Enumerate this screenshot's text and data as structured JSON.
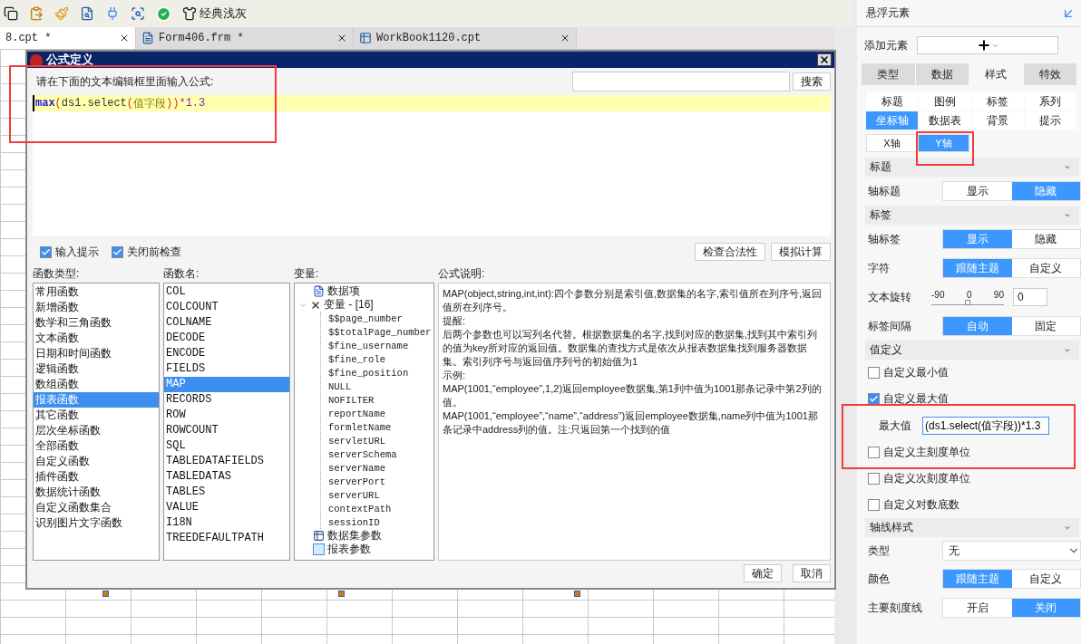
{
  "toolbar": {
    "theme_label": "经典浅灰"
  },
  "tabs": [
    {
      "label": "8.cpt *",
      "selected": true
    },
    {
      "label": "Form406.frm *",
      "selected": false
    },
    {
      "label": "WorkBook1120.cpt",
      "selected": false
    }
  ],
  "dialog": {
    "title": "公式定义",
    "prompt": "请在下面的文本编辑框里面输入公式:",
    "search_button": "搜索",
    "formula": [
      {
        "kind": "function",
        "text": "max"
      },
      {
        "kind": "paren",
        "text": "("
      },
      {
        "kind": "plain",
        "text": "ds1.select"
      },
      {
        "kind": "paren",
        "text": "("
      },
      {
        "kind": "field",
        "text": "值字段"
      },
      {
        "kind": "paren",
        "text": "))"
      },
      {
        "kind": "number",
        "text": "*1.3"
      }
    ],
    "options": [
      {
        "label": "输入提示",
        "checked": true
      },
      {
        "label": "关闭前检查",
        "checked": true
      }
    ],
    "tool_buttons": [
      "检查合法性",
      "模拟计算"
    ],
    "function_types": {
      "heading": "函数类型:",
      "items": [
        {
          "label": "常用函数",
          "selected": false
        },
        {
          "label": "新增函数",
          "selected": false
        },
        {
          "label": "数学和三角函数",
          "selected": false
        },
        {
          "label": "文本函数",
          "selected": false
        },
        {
          "label": "日期和时间函数",
          "selected": false
        },
        {
          "label": "逻辑函数",
          "selected": false
        },
        {
          "label": "数组函数",
          "selected": false
        },
        {
          "label": "报表函数",
          "selected": true
        },
        {
          "label": "其它函数",
          "selected": false
        },
        {
          "label": "层次坐标函数",
          "selected": false
        },
        {
          "label": "全部函数",
          "selected": false
        },
        {
          "label": "自定义函数",
          "selected": false
        },
        {
          "label": "插件函数",
          "selected": false
        },
        {
          "label": "数据统计函数",
          "selected": false
        },
        {
          "label": "自定义函数集合",
          "selected": false
        },
        {
          "label": "识别图片文字函数",
          "selected": false
        }
      ]
    },
    "function_names": {
      "heading": "函数名:",
      "items": [
        {
          "label": "COL",
          "selected": false
        },
        {
          "label": "COLCOUNT",
          "selected": false
        },
        {
          "label": "COLNAME",
          "selected": false
        },
        {
          "label": "DECODE",
          "selected": false
        },
        {
          "label": "ENCODE",
          "selected": false
        },
        {
          "label": "FIELDS",
          "selected": false
        },
        {
          "label": "MAP",
          "selected": true
        },
        {
          "label": "RECORDS",
          "selected": false
        },
        {
          "label": "ROW",
          "selected": false
        },
        {
          "label": "ROWCOUNT",
          "selected": false
        },
        {
          "label": "SQL",
          "selected": false
        },
        {
          "label": "TABLEDATAFIELDS",
          "selected": false
        },
        {
          "label": "TABLEDATAS",
          "selected": false
        },
        {
          "label": "TABLES",
          "selected": false
        },
        {
          "label": "VALUE",
          "selected": false
        },
        {
          "label": "I18N",
          "selected": false
        },
        {
          "label": "TREEDEFAULTPATH",
          "selected": false
        }
      ]
    },
    "variables": {
      "heading": "变量:",
      "items": [
        {
          "kind": "data",
          "label": "数据项"
        },
        {
          "kind": "variables",
          "label": "变量 - [16]",
          "expanded": true,
          "children": [
            {
              "label": "$$page_number"
            },
            {
              "label": "$$totalPage_number"
            },
            {
              "label": "$fine_username"
            },
            {
              "label": "$fine_role"
            },
            {
              "label": "$fine_position"
            },
            {
              "label": "NULL"
            },
            {
              "label": "NOFILTER"
            },
            {
              "label": "reportName"
            },
            {
              "label": "formletName"
            },
            {
              "label": "servletURL"
            },
            {
              "label": "serverSchema"
            },
            {
              "label": "serverName"
            },
            {
              "label": "serverPort"
            },
            {
              "label": "serverURL"
            },
            {
              "label": "contextPath"
            },
            {
              "label": "sessionID"
            }
          ]
        },
        {
          "kind": "dataset",
          "label": "数据集参数"
        },
        {
          "kind": "report",
          "label": "报表参数"
        }
      ]
    },
    "description": {
      "heading": "公式说明:",
      "paragraphs": [
        "MAP(object,string,int,int):四个参数分别是索引值,数据集的名字,索引值所在列序号,返回值所在列序号。",
        "提醒:",
        "后两个参数也可以写列名代替。根据数据集的名字,找到对应的数据集,找到其中索引列的值为key所对应的返回值。数据集的查找方式是依次从报表数据集找到服务器数据集。索引列序号与返回值序列号的初始值为1",
        "示例:",
        "MAP(1001,“employee”,1,2)返回employee数据集,第1列中值为1001那条记录中第2列的值。",
        "MAP(1001,“employee”,“name”,“address”)返回employee数据集,name列中值为1001那条记录中address列的值。注:只返回第一个找到的值"
      ]
    },
    "footer_buttons": [
      "确定",
      "取消"
    ]
  },
  "panel": {
    "title": "悬浮元素",
    "add_label": "添加元素",
    "main_tabs": [
      {
        "label": "类型",
        "selected": false
      },
      {
        "label": "数据",
        "selected": false
      },
      {
        "label": "样式",
        "selected": true
      },
      {
        "label": "特效",
        "selected": false
      }
    ],
    "sub_tabs": [
      {
        "label": "标题",
        "selected": false
      },
      {
        "label": "图例",
        "selected": false
      },
      {
        "label": "标签",
        "selected": false
      },
      {
        "label": "系列",
        "selected": false
      },
      {
        "label": "坐标轴",
        "selected": true
      },
      {
        "label": "数据表",
        "selected": false
      },
      {
        "label": "背景",
        "selected": false
      },
      {
        "label": "提示",
        "selected": false
      }
    ],
    "axis_tabs": [
      {
        "label": "X轴",
        "selected": false
      },
      {
        "label": "Y轴",
        "selected": true
      }
    ],
    "sections": [
      {
        "title": "标题",
        "rows": [
          {
            "kind": "toggle",
            "label": "轴标题",
            "options": [
              {
                "label": "显示",
                "selected": false
              },
              {
                "label": "隐藏",
                "selected": true
              }
            ]
          }
        ]
      },
      {
        "title": "标签",
        "rows": [
          {
            "kind": "toggle",
            "label": "轴标签",
            "options": [
              {
                "label": "显示",
                "selected": true
              },
              {
                "label": "隐藏",
                "selected": false
              }
            ]
          },
          {
            "kind": "toggle",
            "label": "字符",
            "options": [
              {
                "label": "跟随主题",
                "selected": true
              },
              {
                "label": "自定义",
                "selected": false
              }
            ]
          },
          {
            "kind": "slider",
            "label": "文本旋转",
            "ticks": [
              "-90",
              "0",
              "90"
            ],
            "level": 0.5,
            "value": "0"
          },
          {
            "kind": "toggle",
            "label": "标签间隔",
            "options": [
              {
                "label": "自动",
                "selected": true
              },
              {
                "label": "固定",
                "selected": false
              }
            ]
          }
        ]
      },
      {
        "title": "值定义",
        "rows": [
          {
            "kind": "checkbox",
            "label": "自定义最小值",
            "checked": false
          },
          {
            "kind": "checkbox",
            "label": "自定义最大值",
            "checked": true
          },
          {
            "kind": "field",
            "label": "最大值",
            "value": "(ds1.select(值字段))*1.3"
          },
          {
            "kind": "checkbox",
            "label": "自定义主刻度单位",
            "checked": false
          },
          {
            "kind": "checkbox",
            "label": "自定义次刻度单位",
            "checked": false
          },
          {
            "kind": "checkbox",
            "label": "自定义对数底数",
            "checked": false
          }
        ]
      },
      {
        "title": "轴线样式",
        "rows": [
          {
            "kind": "select",
            "label": "类型",
            "value": "无"
          },
          {
            "kind": "toggle",
            "label": "颜色",
            "options": [
              {
                "label": "跟随主题",
                "selected": true
              },
              {
                "label": "自定义",
                "selected": false
              }
            ]
          },
          {
            "kind": "toggle",
            "label": "主要刻度线",
            "options": [
              {
                "label": "开启",
                "selected": false
              },
              {
                "label": "关闭",
                "selected": true
              }
            ]
          }
        ]
      }
    ]
  }
}
